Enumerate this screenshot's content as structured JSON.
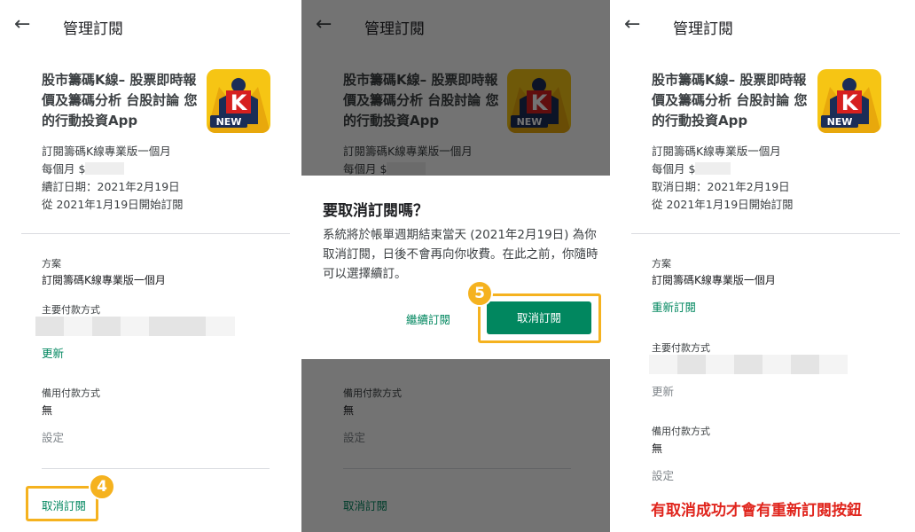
{
  "header": {
    "back_icon": "arrow-back-icon",
    "title": "管理訂閱"
  },
  "app": {
    "title": "股市籌碼K線– 股票即時報價及籌碼分析 台股討論 您的行動投資App",
    "icon_letter": "K",
    "icon_badge": "NEW",
    "colors": {
      "icon_bg": "#f6c514",
      "icon_red": "#d6201f",
      "icon_navy": "#1b2d57"
    }
  },
  "subscription": {
    "plan_name": "訂閱籌碼K線專業版一個月",
    "price_prefix": "每個月 $",
    "renewal_date": "續訂日期：2021年2月19日",
    "cancel_date": "取消日期：2021年2月19日",
    "start_date": "從 2021年1月19日開始訂閱"
  },
  "sections": {
    "plan_label": "方案",
    "plan_value": "訂閱籌碼K線專業版一個月",
    "resubscribe_link": "重新訂閱",
    "primary_payment_label": "主要付款方式",
    "update_link": "更新",
    "backup_payment_label": "備用付款方式",
    "backup_payment_value": "無",
    "settings_link": "設定",
    "cancel_link": "取消訂閱"
  },
  "dialog": {
    "title": "要取消訂閱嗎？",
    "body": "系統將於帳單週期結束當天 (2021年2月19日) 為你取消訂閱，日後不會再向你收費。在此之前，你隨時可以選擇續訂。",
    "continue_button": "繼續訂閱",
    "cancel_button": "取消訂閱"
  },
  "annotations": {
    "step4": "4",
    "step5": "5",
    "note": "有取消成功才會有重新訂閱按鈕",
    "colors": {
      "highlight": "#f5b21f",
      "note": "#e0251d",
      "accent": "#01875f"
    }
  }
}
